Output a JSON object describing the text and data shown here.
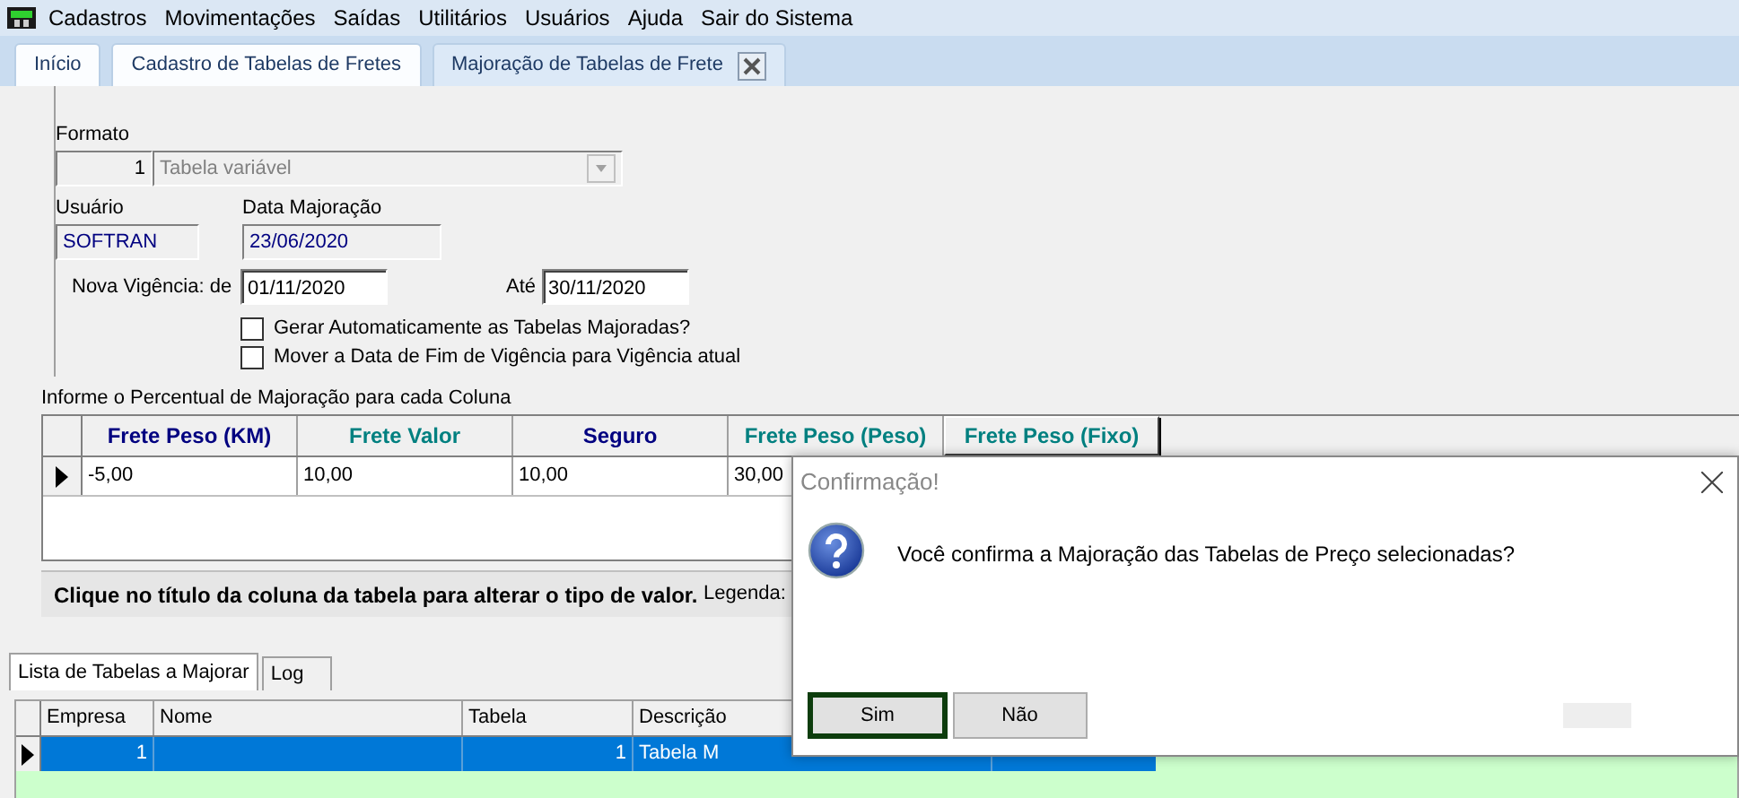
{
  "menu": [
    {
      "label": "Cadastros"
    },
    {
      "label": "Movimentações"
    },
    {
      "label": "Saídas"
    },
    {
      "label": "Utilitários"
    },
    {
      "label": "Usuários"
    },
    {
      "label": "Ajuda"
    },
    {
      "label": "Sair do Sistema"
    }
  ],
  "tabs": [
    {
      "label": "Início",
      "selected": false,
      "closable": false
    },
    {
      "label": "Cadastro de Tabelas de Fretes",
      "selected": false,
      "closable": false
    },
    {
      "label": "Majoração de Tabelas de Frete",
      "selected": true,
      "closable": true
    }
  ],
  "form": {
    "formato_label": "Formato",
    "formato_code": "1",
    "formato_value": "Tabela variável",
    "usuario_label": "Usuário",
    "usuario_value": "SOFTRAN",
    "data_label": "Data Majoração",
    "data_value": "23/06/2020",
    "vigencia_label": "Nova Vigência: de",
    "vigencia_de": "01/11/2020",
    "ate_label": "Até",
    "vigencia_ate": "30/11/2020",
    "checkboxes": [
      {
        "label": "Gerar Automaticamente as Tabelas Majoradas?",
        "checked": false
      },
      {
        "label": "Mover a Data de Fim de Vigência para Vigência atual",
        "checked": false
      }
    ]
  },
  "percent_grid": {
    "caption": "Informe o Percentual de Majoração para cada Coluna",
    "columns": [
      {
        "label": "Frete Peso (KM)",
        "color": "#000080",
        "selected": false
      },
      {
        "label": "Frete Valor",
        "color": "#008080",
        "selected": false
      },
      {
        "label": "Seguro",
        "color": "#000080",
        "selected": false
      },
      {
        "label": "Frete Peso (Peso)",
        "color": "#008080",
        "selected": false
      },
      {
        "label": "Frete Peso (Fixo)",
        "color": "#008080",
        "selected": true
      }
    ],
    "rows": [
      {
        "current": true,
        "cells": [
          "-5,00",
          "10,00",
          "10,00",
          "30,00"
        ]
      }
    ]
  },
  "hint": "Clique no título da coluna da tabela para alterar o tipo de valor.",
  "legend_label": "Legenda:",
  "bottom_tabs": [
    {
      "label": "Lista de Tabelas a Majorar",
      "selected": true
    },
    {
      "label": "Log",
      "selected": false
    }
  ],
  "list_grid": {
    "columns": [
      "Empresa",
      "Nome",
      "Tabela",
      "Descrição"
    ],
    "rows": [
      {
        "selected": true,
        "empresa": "1",
        "tabela": "1",
        "descricao": "Tabela M"
      }
    ]
  },
  "dialog": {
    "title": "Confirmação!",
    "message": "Você confirma a Majoração das Tabelas de Preço selecionadas?",
    "buttons": [
      {
        "label": "Sim",
        "default": true
      },
      {
        "label": "Não",
        "default": false
      }
    ]
  }
}
